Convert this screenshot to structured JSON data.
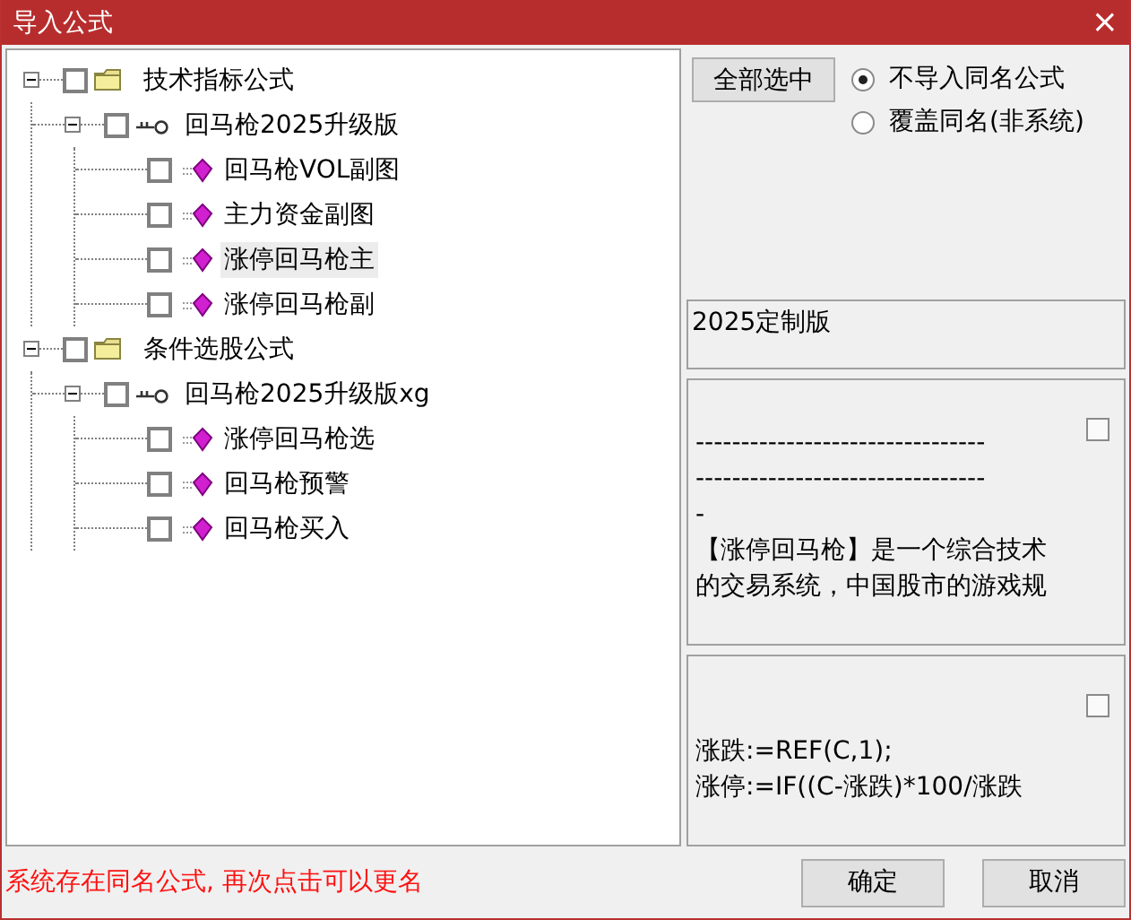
{
  "window": {
    "title": "导入公式",
    "close": "×"
  },
  "tree": [
    {
      "label": "技术指标公式",
      "kind": "folder",
      "expanded": true,
      "checked": false,
      "selected": false,
      "children": [
        {
          "label": "回马枪2025升级版",
          "kind": "group",
          "expanded": true,
          "checked": false,
          "selected": false,
          "children": [
            {
              "label": "回马枪VOL副图",
              "kind": "formula",
              "checked": false,
              "selected": false
            },
            {
              "label": "主力资金副图",
              "kind": "formula",
              "checked": false,
              "selected": false
            },
            {
              "label": "涨停回马枪主",
              "kind": "formula",
              "checked": false,
              "selected": true
            },
            {
              "label": "涨停回马枪副",
              "kind": "formula",
              "checked": false,
              "selected": false
            }
          ]
        }
      ]
    },
    {
      "label": "条件选股公式",
      "kind": "folder",
      "expanded": true,
      "checked": false,
      "selected": false,
      "children": [
        {
          "label": "回马枪2025升级版xg",
          "kind": "group",
          "expanded": true,
          "checked": false,
          "selected": false,
          "children": [
            {
              "label": "涨停回马枪选",
              "kind": "formula",
              "checked": false,
              "selected": false
            },
            {
              "label": "回马枪预警",
              "kind": "formula",
              "checked": false,
              "selected": false
            },
            {
              "label": "回马枪买入",
              "kind": "formula",
              "checked": false,
              "selected": false
            }
          ]
        }
      ]
    }
  ],
  "select_all_button": "全部选中",
  "options": [
    {
      "label": "不导入同名公式",
      "selected": true
    },
    {
      "label": "覆盖同名(非系统)",
      "selected": false
    }
  ],
  "version_field": {
    "value": "2025定制版"
  },
  "description": {
    "checked": false,
    "lines": [
      "--------------------------------",
      "--------------------------------",
      "-",
      "【涨停回马枪】是一个综合技术",
      "的交易系统，中国股市的游戏规"
    ]
  },
  "code": {
    "checked": false,
    "lines": [
      "涨跌:=REF(C,1);",
      "涨停:=IF((C-涨跌)*100/涨跌"
    ]
  },
  "status_message": "系统存在同名公式, 再次点击可以更名",
  "buttons": [
    "确定",
    "取消"
  ]
}
